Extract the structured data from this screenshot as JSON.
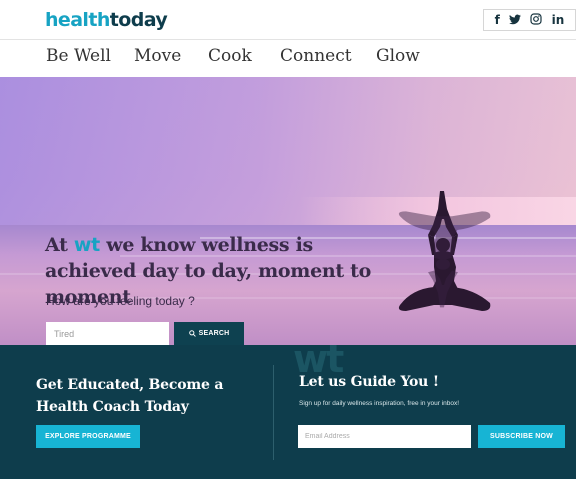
{
  "header": {
    "logo_part1": "health",
    "logo_part2": "today",
    "social": {
      "facebook": "f",
      "twitter": "🐦",
      "instagram": "◎",
      "linkedin": "in"
    }
  },
  "nav": {
    "items": [
      {
        "label": "Be Well"
      },
      {
        "label": "Move"
      },
      {
        "label": "Cook"
      },
      {
        "label": "Connect"
      },
      {
        "label": "Glow"
      }
    ]
  },
  "hero": {
    "headline_pre": "At ",
    "headline_wt": "wt",
    "headline_post": " we know wellness is achieved day to day, moment to moment",
    "question": "How are you feeling today ?",
    "search_placeholder": "Tired",
    "search_label": "SEARCH",
    "search_icon": "search-icon"
  },
  "footer": {
    "watermark": "wt",
    "education_title": "Get Educated, Become a Health Coach Today",
    "explore_label": "EXPLORE PROGRAMME",
    "guide_title": "Let us Guide You !",
    "guide_subtitle": "Sign up for daily wellness inspiration, free in your inbox!",
    "email_placeholder": "Email Address",
    "subscribe_label": "SUBSCRIBE NOW"
  },
  "colors": {
    "brand_light": "#17a3c3",
    "brand_dark": "#0e3d4c",
    "accent_button": "#17b4d4"
  }
}
